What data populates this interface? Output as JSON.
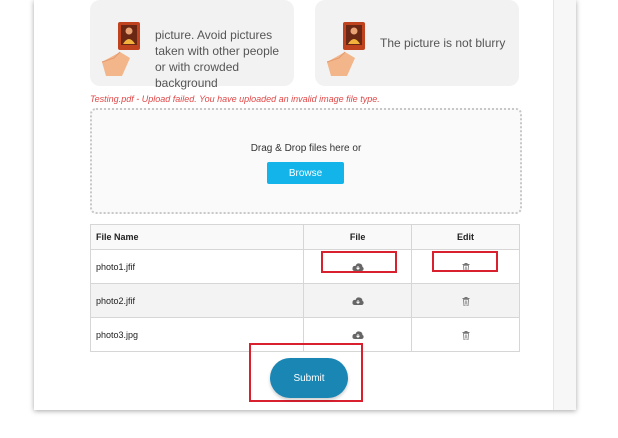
{
  "tips": {
    "card1_text": "picture. Avoid pictures taken with other people or with crowded background",
    "card2_text": "The picture is not blurry"
  },
  "upload": {
    "error_message": "Testing.pdf - Upload failed. You have uploaded an invalid image file type.",
    "drop_text": "Drag & Drop files here or",
    "browse_label": "Browse"
  },
  "table": {
    "headers": [
      "File Name",
      "File",
      "Edit"
    ],
    "rows": [
      {
        "file_name": "photo1.jfif",
        "file_icon": "cloud-download-icon",
        "edit_icon": "trash-icon"
      },
      {
        "file_name": "photo2.jfif",
        "file_icon": "cloud-download-icon",
        "edit_icon": "trash-icon"
      },
      {
        "file_name": "photo3.jpg",
        "file_icon": "cloud-download-icon",
        "edit_icon": "trash-icon"
      }
    ]
  },
  "submit_label": "Submit",
  "colors": {
    "browse": "#12b4ea",
    "submit": "#1a86b4",
    "error": "#e04848",
    "highlight": "#d9202f"
  }
}
